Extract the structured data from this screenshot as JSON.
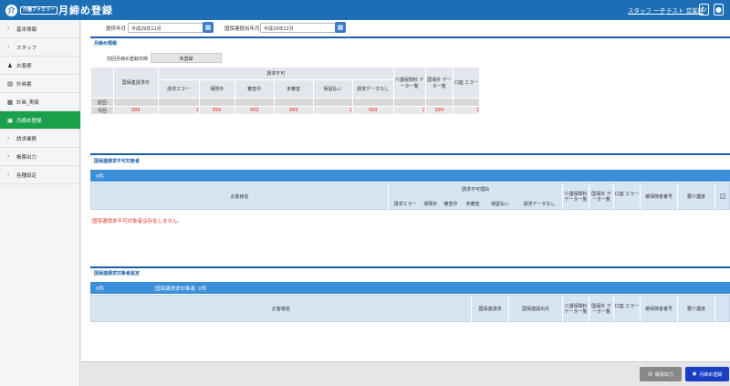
{
  "app": {
    "logo_mark": "介",
    "logo_text": "介護ファミリー",
    "title": "月締め登録"
  },
  "header": {
    "user1": "スタッフ 一子",
    "user2": "テスト 営業所",
    "refresh_icon": "↻",
    "help_icon": "●"
  },
  "sidebar": {
    "items": [
      {
        "label": "基本情報",
        "icon": "chevron"
      },
      {
        "label": "スタッフ",
        "icon": "chevron"
      },
      {
        "label": "お客様",
        "icon": "person-icon"
      },
      {
        "label": "計画書",
        "icon": "document-icon"
      },
      {
        "label": "計画_実績",
        "icon": "calendar-icon"
      },
      {
        "label": "月締め登録",
        "icon": "save-icon"
      },
      {
        "label": "請求業務",
        "icon": "chevron"
      },
      {
        "label": "帳票出力",
        "icon": "chevron"
      },
      {
        "label": "各種設定",
        "icon": "chevron"
      }
    ]
  },
  "form": {
    "label_month": "提供年月",
    "value_month": "平成29年11月",
    "label_submit": "国保連提出年月",
    "value_submit": "平成29年12月"
  },
  "prev": {
    "title": "月締め情報",
    "label": "前回月締め登録日時",
    "value": "未登録",
    "col_kokuho": "国保連請求可",
    "col_group": "請求不可",
    "subcols": [
      "請求エラー",
      "保険外",
      "審査中",
      "未審査",
      "保留払い",
      "請求データなし"
    ],
    "col_kaigo": "介護保険料 データ一覧",
    "col_kokuho_list": "国保外 データ一覧",
    "col_err": "口座 エラー",
    "rows": [
      {
        "label": "前回",
        "values": [
          "",
          "",
          "",
          "",
          "",
          "",
          "",
          "",
          "",
          ""
        ]
      },
      {
        "label": "今回",
        "values": [
          "999",
          "1",
          "999",
          "999",
          "999",
          "1",
          "999",
          "1",
          "999",
          "1"
        ]
      }
    ]
  },
  "ng": {
    "title": "国保連請求不可対象者",
    "count": "0件",
    "col_name": "お客様名",
    "col_group": "請求不可理由",
    "subcols": [
      "請求エラー",
      "保険外",
      "審査中",
      "未審査",
      "保留払い",
      "請求データなし"
    ],
    "col_kaigo": "介護保険料 データ一覧",
    "col_kokuho_list": "国保外 データ一覧",
    "col_err": "口座 エラー",
    "col_num": "被保険者番号",
    "col_care": "要介護度",
    "empty": "国保連請求不可対象者は存在しません。"
  },
  "target": {
    "title": "国保連請求対象者設定",
    "count": "0件",
    "count_label": "国保連請求対象者: 0件",
    "col_name": "お客様名",
    "col_kokuho": "国保連請求",
    "col_month": "国保連提出月",
    "col_kaigo": "介護保険料 データ一覧",
    "col_kokuho_list": "国保外 データ一覧",
    "col_err": "口座 エラー",
    "col_num": "被保険者番号",
    "col_care": "要介護度"
  },
  "footer": {
    "print_label": "帳票出力",
    "register_label": "月締め登録"
  },
  "colors": {
    "brand": "#1c6fb5",
    "active": "#1aa04a",
    "error": "#e33333"
  }
}
